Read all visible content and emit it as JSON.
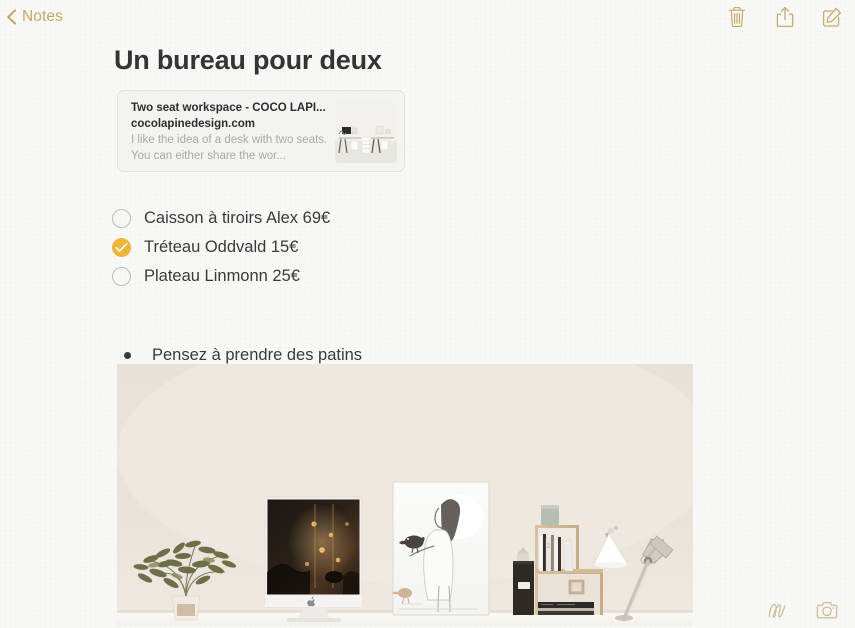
{
  "app": {
    "name": "Notes",
    "accent_color": "#c6a863",
    "background_color": "#f8f8f6",
    "text_color": "#3a3a3a"
  },
  "topbar": {
    "back_label": "Notes",
    "back_icon": "chevron-left-icon",
    "actions": [
      {
        "name": "trash-icon",
        "label": "Delete"
      },
      {
        "name": "share-icon",
        "label": "Share"
      },
      {
        "name": "compose-icon",
        "label": "Compose"
      }
    ]
  },
  "note": {
    "title": "Un bureau pour deux",
    "link_card": {
      "title": "Two seat workspace - COCO LAPI...",
      "domain": "cocolapinedesign.com",
      "description": "I like the idea of a desk with two seats. You can either share the wor...",
      "thumbnail_alt": "two-seat-white-workspace-thumbnail"
    },
    "checklist": [
      {
        "label": "Caisson à tiroirs Alex 69€",
        "checked": false
      },
      {
        "label": "Tréteau Oddvald 15€",
        "checked": true
      },
      {
        "label": "Plateau Linmonn 25€",
        "checked": false
      }
    ],
    "checked_color": "#f0b437",
    "unchecked_border_color": "#bcbcb9",
    "bullets": [
      {
        "label": "Pensez à prendre des patins"
      }
    ],
    "photo": {
      "alt": "minimalist-workspace-photo",
      "description": "Desk with plant, iMac, framed art print, wooden shelf with books and desk lamp"
    }
  },
  "bottombar": {
    "actions": [
      {
        "name": "markup-icon",
        "label": "Markup"
      },
      {
        "name": "camera-icon",
        "label": "Camera"
      }
    ]
  }
}
